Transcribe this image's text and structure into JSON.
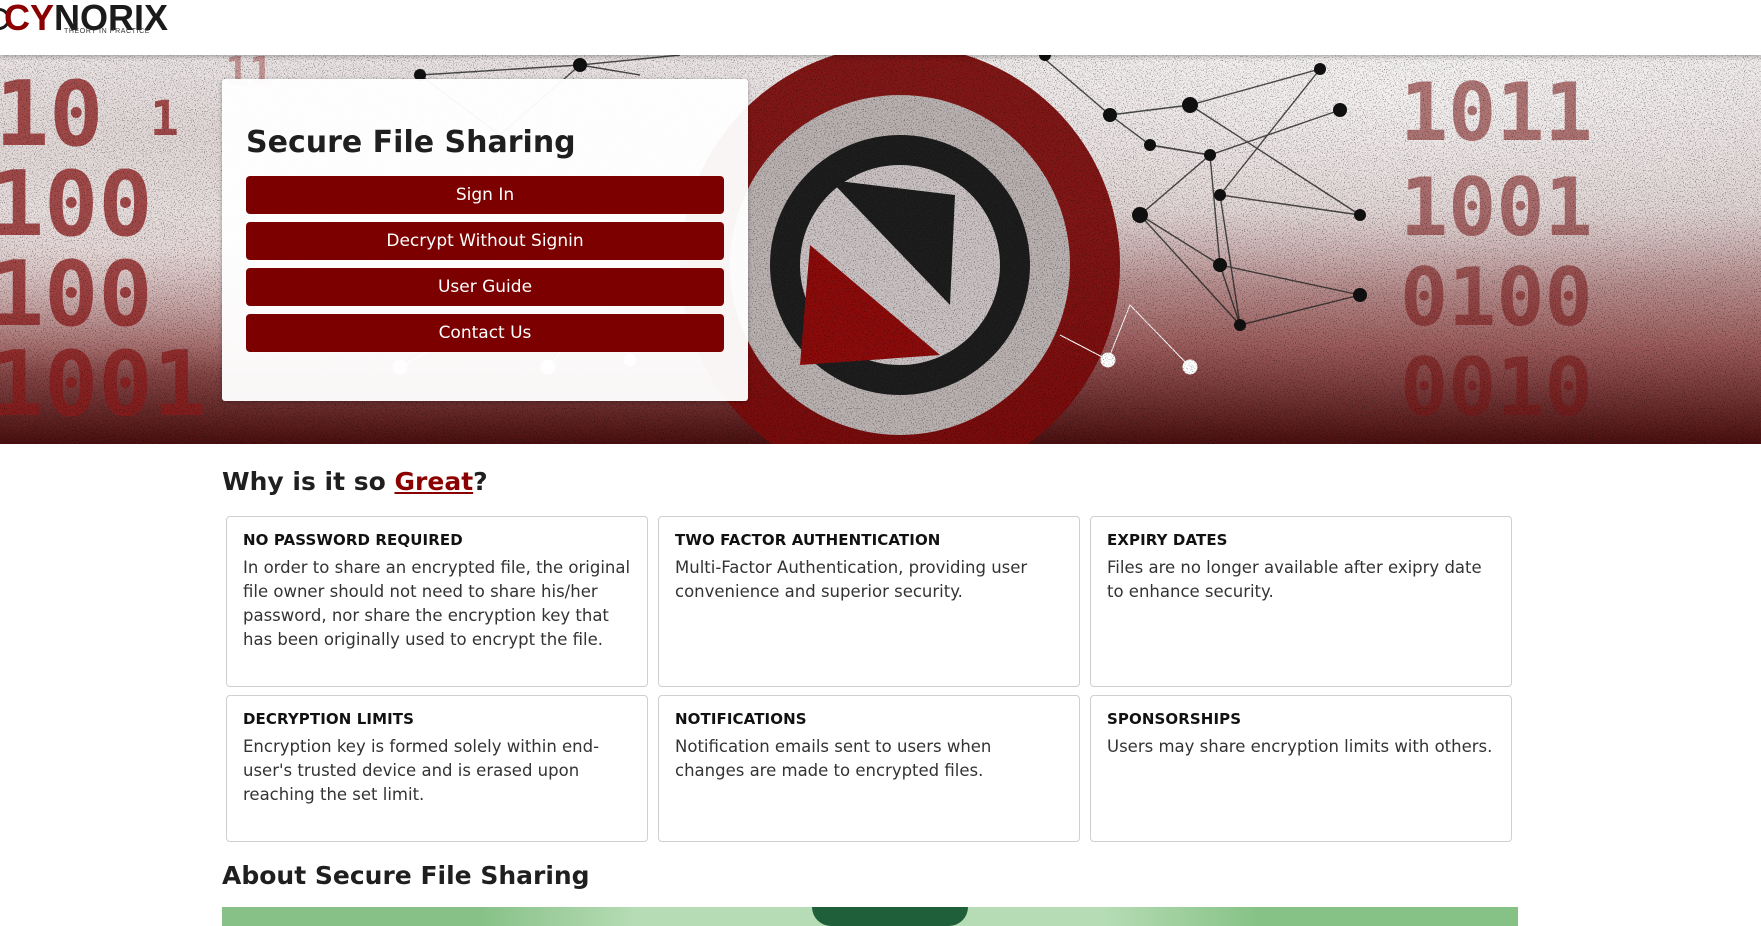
{
  "header": {
    "logo_cy": "CY",
    "logo_norix": "NORIX",
    "logo_tagline": "THEORY IN PRACTICE"
  },
  "hero": {
    "title": "Secure File Sharing",
    "buttons": [
      "Sign In",
      "Decrypt Without Signin",
      "User Guide",
      "Contact Us"
    ]
  },
  "features": {
    "heading_prefix": "Why is it so ",
    "heading_link": "Great",
    "heading_suffix": "?",
    "cards": [
      {
        "title": "NO PASSWORD REQUIRED",
        "text": "In order to share an encrypted file, the original file owner should not need to share his/her password, nor share the encryption key that has been originally used to encrypt the file."
      },
      {
        "title": "TWO FACTOR AUTHENTICATION",
        "text": "Multi-Factor Authentication, providing user convenience and superior security."
      },
      {
        "title": "EXPIRY DATES",
        "text": "Files are no longer available after exipry date to enhance security."
      },
      {
        "title": "DECRYPTION LIMITS",
        "text": "Encryption key is formed solely within end-user's trusted device and is erased upon reaching the set limit."
      },
      {
        "title": "NOTIFICATIONS",
        "text": "Notification emails sent to users when changes are made to encrypted files."
      },
      {
        "title": "SPONSORSHIPS",
        "text": "Users may share encryption limits with others."
      }
    ]
  },
  "about": {
    "heading": "About Secure File Sharing"
  },
  "colors": {
    "accent": "#7d0000",
    "link": "#8b0000"
  }
}
